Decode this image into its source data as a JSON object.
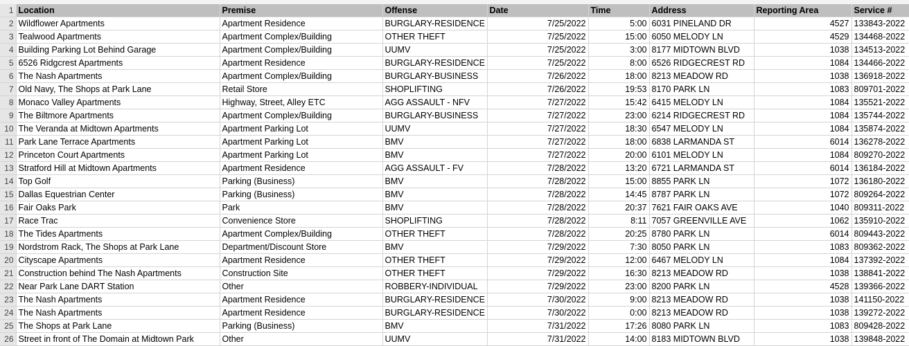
{
  "headers": [
    "Location",
    "Premise",
    "Offense",
    "Date",
    "Time",
    "Address",
    "Reporting Area",
    "Service #"
  ],
  "rows": [
    [
      "Wildflower Apartments",
      "Apartment Residence",
      "BURGLARY-RESIDENCE",
      "7/25/2022",
      "5:00",
      "6031 PINELAND DR",
      "4527",
      "133843-2022"
    ],
    [
      "Tealwood Apartments",
      "Apartment Complex/Building",
      "OTHER THEFT",
      "7/25/2022",
      "15:00",
      "6050 MELODY LN",
      "4529",
      "134468-2022"
    ],
    [
      "Building Parking Lot Behind Garage",
      "Apartment Complex/Building",
      "UUMV",
      "7/25/2022",
      "3:00",
      "8177 MIDTOWN BLVD",
      "1038",
      "134513-2022"
    ],
    [
      "6526 Ridgcrest Apartments",
      "Apartment Residence",
      "BURGLARY-RESIDENCE",
      "7/25/2022",
      "8:00",
      "6526 RIDGECREST RD",
      "1084",
      "134466-2022"
    ],
    [
      "The Nash Apartments",
      "Apartment Complex/Building",
      "BURGLARY-BUSINESS",
      "7/26/2022",
      "18:00",
      "8213 MEADOW RD",
      "1038",
      "136918-2022"
    ],
    [
      "Old Navy, The Shops at Park Lane",
      "Retail Store",
      "SHOPLIFTING",
      "7/26/2022",
      "19:53",
      "8170 PARK LN",
      "1083",
      "809701-2022"
    ],
    [
      "Monaco Valley Apartments",
      "Highway, Street, Alley ETC",
      "AGG ASSAULT - NFV",
      "7/27/2022",
      "15:42",
      "6415 MELODY LN",
      "1084",
      "135521-2022"
    ],
    [
      "The Biltmore Apartments",
      "Apartment Complex/Building",
      "BURGLARY-BUSINESS",
      "7/27/2022",
      "23:00",
      "6214 RIDGECREST RD",
      "1084",
      "135744-2022"
    ],
    [
      "The Veranda at Midtown Apartments",
      "Apartment Parking Lot",
      "UUMV",
      "7/27/2022",
      "18:30",
      "6547 MELODY LN",
      "1084",
      "135874-2022"
    ],
    [
      "Park Lane Terrace Apartments",
      "Apartment Parking Lot",
      "BMV",
      "7/27/2022",
      "18:00",
      "6838 LARMANDA ST",
      "6014",
      "136278-2022"
    ],
    [
      "Princeton Court Apartments",
      "Apartment Parking Lot",
      "BMV",
      "7/27/2022",
      "20:00",
      "6101 MELODY LN",
      "1084",
      "809270-2022"
    ],
    [
      "Stratford Hill at Midtown Apartments",
      "Apartment Residence",
      "AGG ASSAULT - FV",
      "7/28/2022",
      "13:20",
      "6721 LARMANDA ST",
      "6014",
      "136184-2022"
    ],
    [
      "Top Golf",
      "Parking (Business)",
      "BMV",
      "7/28/2022",
      "15:00",
      "8855 PARK LN",
      "1072",
      "136180-2022"
    ],
    [
      "Dallas Equestrian Center",
      "Parking (Business)",
      "BMV",
      "7/28/2022",
      "14:45",
      "8787 PARK LN",
      "1072",
      "809264-2022"
    ],
    [
      "Fair Oaks Park",
      "Park",
      "BMV",
      "7/28/2022",
      "20:37",
      "7621 FAIR OAKS AVE",
      "1040",
      "809311-2022"
    ],
    [
      "Race Trac",
      "Convenience Store",
      "SHOPLIFTING",
      "7/28/2022",
      "8:11",
      "7057 GREENVILLE AVE",
      "1062",
      "135910-2022"
    ],
    [
      "The Tides Apartments",
      "Apartment Complex/Building",
      "OTHER THEFT",
      "7/28/2022",
      "20:25",
      "8780 PARK LN",
      "6014",
      "809443-2022"
    ],
    [
      "Nordstrom Rack, The Shops at Park Lane",
      "Department/Discount Store",
      "BMV",
      "7/29/2022",
      "7:30",
      "8050 PARK LN",
      "1083",
      "809362-2022"
    ],
    [
      "Cityscape Apartments",
      "Apartment Residence",
      "OTHER THEFT",
      "7/29/2022",
      "12:00",
      "6467 MELODY LN",
      "1084",
      "137392-2022"
    ],
    [
      "Construction behind The Nash Apartments",
      "Construction Site",
      "OTHER THEFT",
      "7/29/2022",
      "16:30",
      "8213 MEADOW RD",
      "1038",
      "138841-2022"
    ],
    [
      "Near Park Lane DART Station",
      "Other",
      "ROBBERY-INDIVIDUAL",
      "7/29/2022",
      "23:00",
      "8200 PARK LN",
      "4528",
      "139366-2022"
    ],
    [
      "The Nash Apartments",
      "Apartment Residence",
      "BURGLARY-RESIDENCE",
      "7/30/2022",
      "9:00",
      "8213 MEADOW RD",
      "1038",
      "141150-2022"
    ],
    [
      "The Nash Apartments",
      "Apartment Residence",
      "BURGLARY-RESIDENCE",
      "7/30/2022",
      "0:00",
      "8213 MEADOW RD",
      "1038",
      "139272-2022"
    ],
    [
      "The Shops at Park Lane",
      "Parking (Business)",
      "BMV",
      "7/31/2022",
      "17:26",
      "8080 PARK LN",
      "1083",
      "809428-2022"
    ],
    [
      "Street in front of The Domain at Midtown Park",
      "Other",
      "UUMV",
      "7/31/2022",
      "14:00",
      "8183 MIDTOWN BLVD",
      "1038",
      "139848-2022"
    ]
  ]
}
